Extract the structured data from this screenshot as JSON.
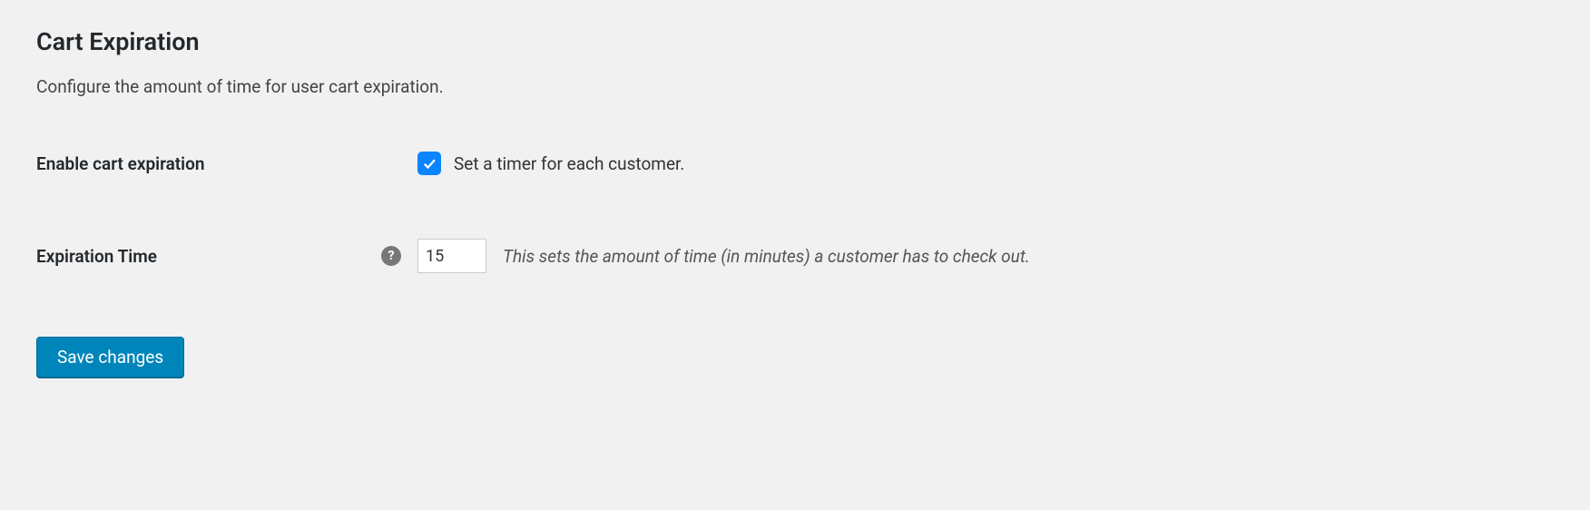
{
  "section": {
    "title": "Cart Expiration",
    "description": "Configure the amount of time for user cart expiration."
  },
  "fields": {
    "enable": {
      "label": "Enable cart expiration",
      "checked": true,
      "description": "Set a timer for each customer."
    },
    "time": {
      "label": "Expiration Time",
      "value": "15",
      "description": "This sets the amount of time (in minutes) a customer has to check out.",
      "help": "?"
    }
  },
  "actions": {
    "save": "Save changes"
  }
}
